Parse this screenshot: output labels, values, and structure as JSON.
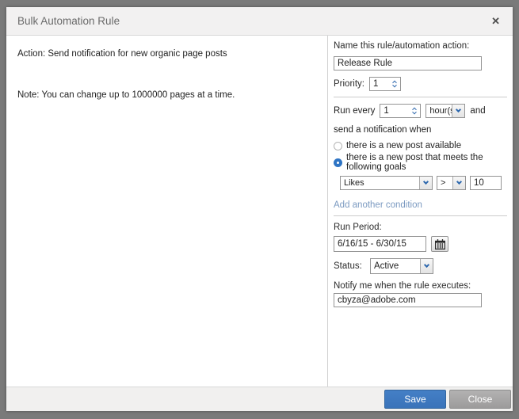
{
  "dialog": {
    "title": "Bulk Automation Rule",
    "close_icon": "✕"
  },
  "left_panel": {
    "action_text": "Action: Send notification for new organic page posts",
    "note_text": "Note: You can change up to 1000000 pages at a time."
  },
  "form": {
    "name_label": "Name this rule/automation action:",
    "name_value": "Release Rule",
    "priority_label": "Priority:",
    "priority_value": "1",
    "run_every_label": "Run every",
    "run_every_value": "1",
    "run_every_unit": "hour(s)",
    "and_label": "and",
    "send_notification_label": "send a notification when",
    "radio_new_post_label": "there is a new post available",
    "radio_goals_label": "there is a new post that meets the following goals",
    "condition": {
      "metric": "Likes",
      "operator": ">",
      "value": "10"
    },
    "add_condition_link": "Add another condition",
    "run_period_label": "Run Period:",
    "run_period_value": "6/16/15 - 6/30/15",
    "status_label": "Status:",
    "status_value": "Active",
    "notify_label": "Notify me when the rule executes:",
    "notify_value": "cbyza@adobe.com"
  },
  "footer": {
    "save_label": "Save",
    "close_label": "Close"
  },
  "colors": {
    "accent_blue": "#2e68ae",
    "radio_selected": "#2e74c4",
    "link_blue": "#7b9ac1",
    "save_button": "#3a73b9",
    "close_button": "#9c9b9b",
    "frame_gray": "#7a7a7a"
  }
}
